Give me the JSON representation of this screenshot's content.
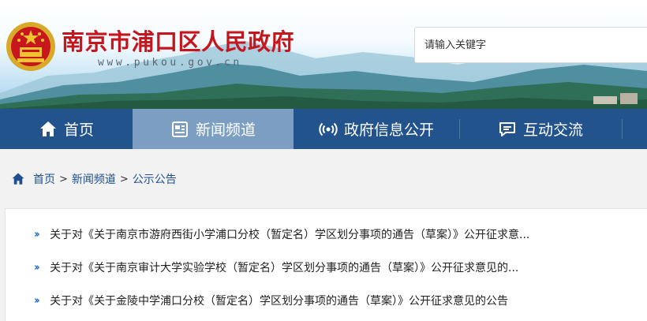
{
  "header": {
    "site_title": "南京市浦口区人民政府",
    "site_url": "www.pukou.gov.cn",
    "search_placeholder": "请输入关键字"
  },
  "nav": {
    "items": [
      {
        "label": "首页",
        "icon": "home-icon"
      },
      {
        "label": "新闻频道",
        "icon": "newspaper-icon",
        "active": true
      },
      {
        "label": "政府信息公开",
        "icon": "broadcast-icon"
      },
      {
        "label": "互动交流",
        "icon": "chat-icon"
      }
    ]
  },
  "breadcrumb": {
    "icon": "home-icon",
    "items": [
      "首页",
      "新闻频道",
      "公示公告"
    ],
    "separator": ">"
  },
  "list": {
    "items": [
      "关于对《关于南京市游府西街小学浦口分校（暂定名）学区划分事项的通告（草案）》公开征求意...",
      "关于对《关于南京审计大学实验学校（暂定名）学区划分事项的通告（草案）》公开征求意见的...",
      "关于对《关于金陵中学浦口分校（暂定名）学区划分事项的通告（草案）》公开征求意见的公告"
    ]
  },
  "colors": {
    "title_red": "#c5161d",
    "nav_blue": "#23538d",
    "nav_active": "#7d9ec3",
    "link_blue": "#1f4f8c",
    "arrow_blue": "#1f6fc4"
  }
}
